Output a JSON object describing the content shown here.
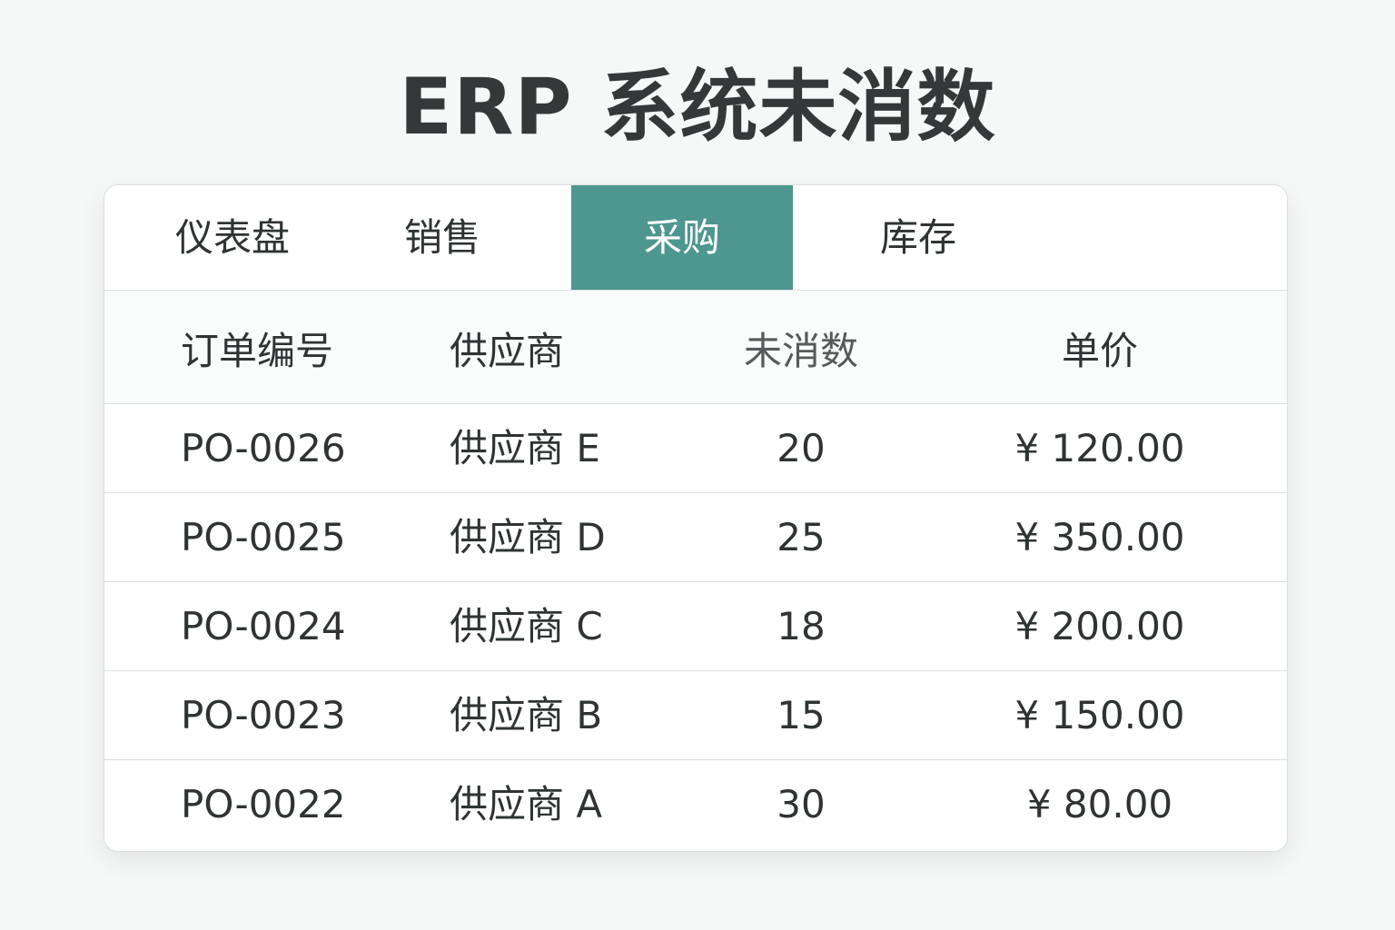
{
  "page": {
    "title": "ERP 系统未消数"
  },
  "tabs": [
    {
      "label": "仪表盘"
    },
    {
      "label": "销售"
    },
    {
      "label": "采购",
      "active": true
    },
    {
      "label": "库存"
    }
  ],
  "colors": {
    "active_tab_bg": "#4e9690",
    "active_tab_text": "#ffffff",
    "background": "#f6f7f7"
  },
  "table": {
    "headers": [
      "订单编号",
      "供应商",
      "未消数",
      "单价"
    ],
    "rows": [
      {
        "order_no": "PO-0026",
        "supplier": "供应商 E",
        "qty": "20",
        "price": "¥ 120.00"
      },
      {
        "order_no": "PO-0025",
        "supplier": "供应商 D",
        "qty": "25",
        "price": "¥ 350.00"
      },
      {
        "order_no": "PO-0024",
        "supplier": "供应商 C",
        "qty": "18",
        "price": "¥ 200.00"
      },
      {
        "order_no": "PO-0023",
        "supplier": "供应商 B",
        "qty": "15",
        "price": "¥ 150.00"
      },
      {
        "order_no": "PO-0022",
        "supplier": "供应商 A",
        "qty": "30",
        "price": "¥ 80.00"
      }
    ]
  }
}
